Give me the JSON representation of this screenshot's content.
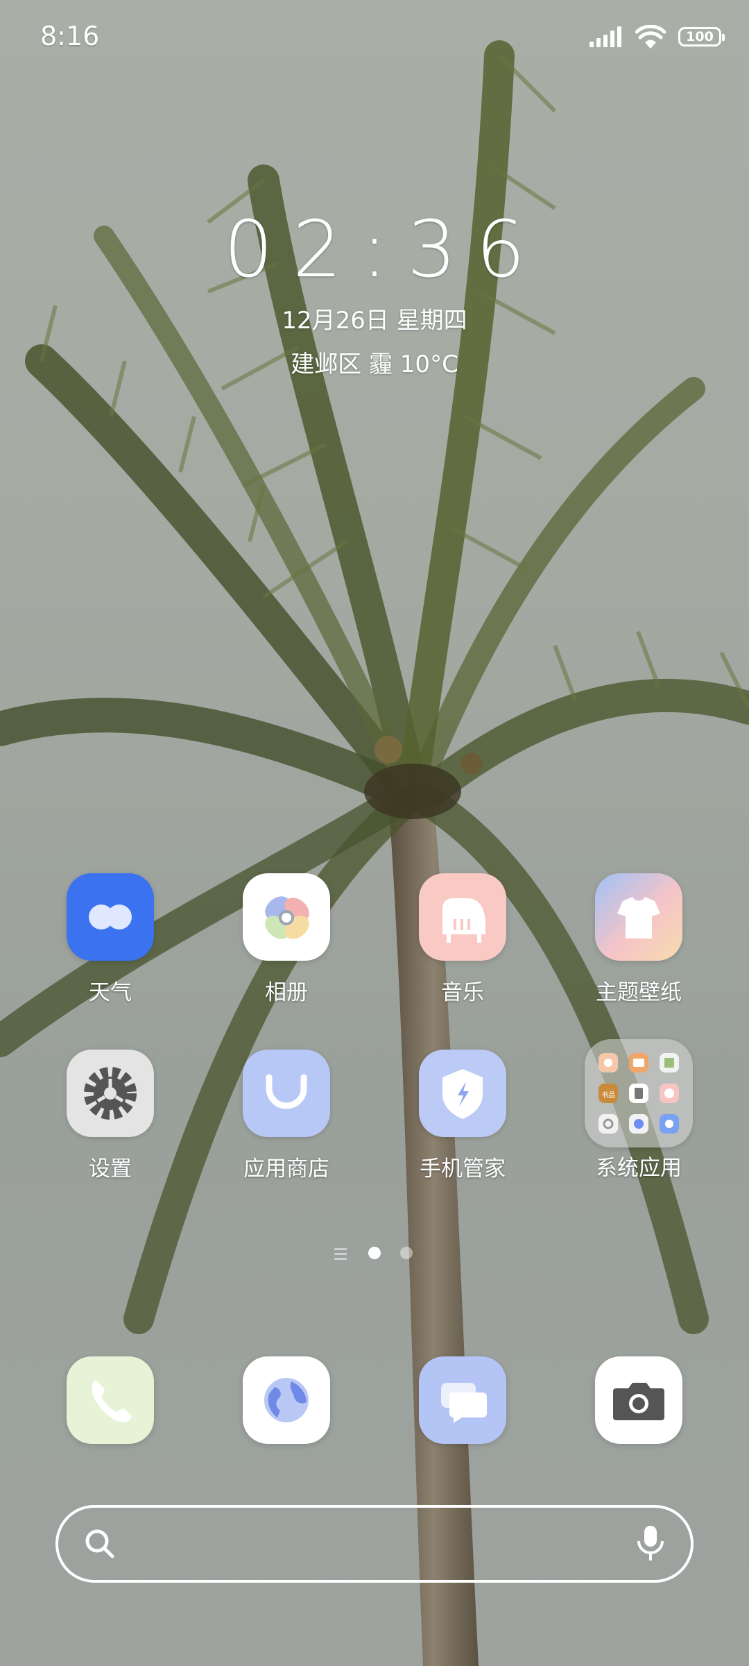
{
  "status_bar": {
    "time": "8:16",
    "battery": "100",
    "icons": [
      "signal-icon",
      "wifi-icon",
      "battery-icon"
    ]
  },
  "clock_widget": {
    "time": "02:36",
    "date": "12月26日 星期四",
    "weather": "建邺区 霾 10°C"
  },
  "apps_row1": [
    {
      "label": "天气",
      "icon": "weather-icon"
    },
    {
      "label": "相册",
      "icon": "gallery-icon"
    },
    {
      "label": "音乐",
      "icon": "music-icon"
    },
    {
      "label": "主题壁纸",
      "icon": "themes-icon"
    }
  ],
  "apps_row2": [
    {
      "label": "设置",
      "icon": "settings-icon"
    },
    {
      "label": "应用商店",
      "icon": "app-store-icon"
    },
    {
      "label": "手机管家",
      "icon": "security-icon"
    },
    {
      "label": "系统应用",
      "icon": "folder-icon"
    }
  ],
  "folder_preview": {
    "mini_label": "书品"
  },
  "page_indicator": {
    "pages": 3,
    "current": 2
  },
  "dock": [
    {
      "icon": "phone-icon"
    },
    {
      "icon": "browser-icon"
    },
    {
      "icon": "messages-icon"
    },
    {
      "icon": "camera-icon"
    }
  ],
  "search_bar": {
    "icons": [
      "search-icon",
      "microphone-icon"
    ]
  }
}
